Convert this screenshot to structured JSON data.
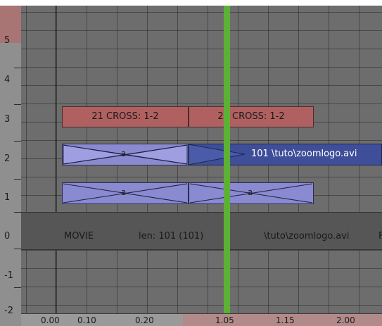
{
  "channels": {
    "labels": [
      "5",
      "4",
      "3",
      "2",
      "1",
      "0",
      "-1",
      "-2"
    ]
  },
  "frame_ruler": {
    "labels": [
      "0.00",
      "0.10",
      "0.20",
      "1.05",
      "1.15",
      "2.00"
    ]
  },
  "strips": {
    "cross_a": "21 CROSS: 1-2",
    "cross_b": "21 CROSS: 1-2",
    "effect_marker": "a",
    "movie_name": "101 \\tuto\\zoomlogo.avi"
  },
  "info_bar": {
    "type": "MOVIE",
    "length": "len: 101 (101)",
    "path": "\\tuto\\zoomlogo.avi",
    "trailing": "F"
  },
  "colors": {
    "cross_strip": "#b06060",
    "effect_strip": "#8a8ad0",
    "movie_strip": "#3e4e98",
    "current_frame": "#5cb135",
    "highlight_channel": "#a97474"
  }
}
